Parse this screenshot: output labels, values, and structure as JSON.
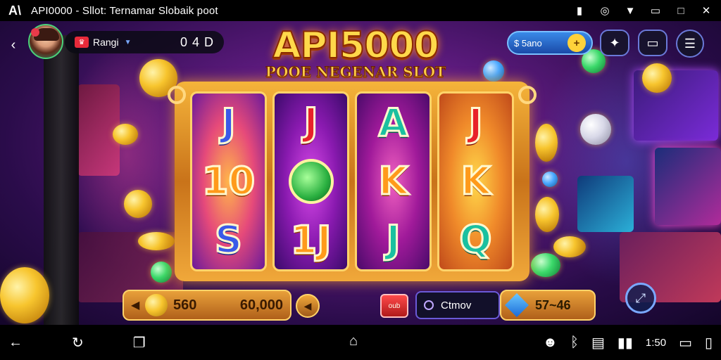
{
  "status_bar": {
    "app_glyph": "A\\",
    "title": "API0000 - Sllot: Ternamar Slobaik poot",
    "icons": [
      "media-icon",
      "circle-icon",
      "wifi-icon",
      "battery-icon",
      "maximize-icon",
      "close-icon"
    ]
  },
  "profile": {
    "rank": "Rangi",
    "balance": "0 4 D"
  },
  "logo": {
    "main": "API5000",
    "sub": "POOE NEGENAR SLOT"
  },
  "top_right": {
    "coin_label": "$ 5ano",
    "plus": "+"
  },
  "reels": [
    {
      "symbols": [
        "J",
        "10",
        "S"
      ],
      "colors": [
        "blue",
        "orange",
        "blue"
      ]
    },
    {
      "symbols": [
        "J",
        "",
        "1J"
      ],
      "colors": [
        "red",
        "green-gem",
        "orange"
      ]
    },
    {
      "symbols": [
        "A",
        "K",
        "J"
      ],
      "colors": [
        "teal",
        "orange",
        "teal"
      ]
    },
    {
      "symbols": [
        "J",
        "K",
        "Q"
      ],
      "colors": [
        "red",
        "orange",
        "teal"
      ]
    }
  ],
  "bottom": {
    "bet_value": "560",
    "bet_total": "60,000",
    "stop_label": "oub",
    "auto_label": "Ctmov",
    "win_value": "57~46"
  },
  "nav": {
    "time": "1:50"
  },
  "colors": {
    "accent": "#ffd84a",
    "frame": "#f0a83a",
    "bg": "#5b1a7c"
  }
}
